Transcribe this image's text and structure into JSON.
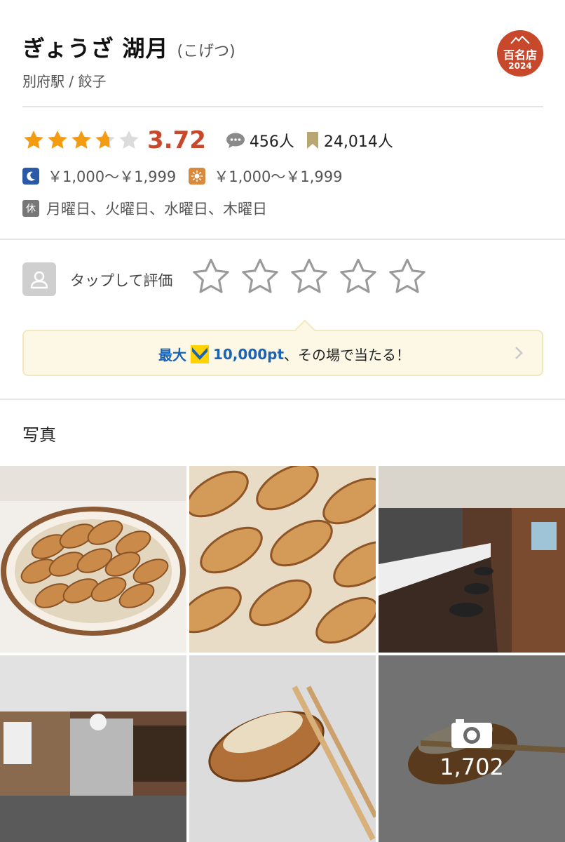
{
  "shop": {
    "name": "ぎょうざ 湖月",
    "kana": "(こげつ)",
    "subtitle": "別府駅 / 餃子",
    "award_label": "百名店",
    "award_year": "2024"
  },
  "rating": {
    "value": 0.744,
    "score": "3.72",
    "reviews": "456人",
    "bookmarks": "24,014人"
  },
  "prices": {
    "dinner": "￥1,000～￥1,999",
    "lunch": "￥1,000～￥1,999"
  },
  "closed": {
    "badge": "休",
    "days": "月曜日、火曜日、水曜日、木曜日"
  },
  "user_rating": {
    "label": "タップして評価",
    "stars": 5
  },
  "promo": {
    "prefix": "最大",
    "points": "10,000pt",
    "suffix": "、その場で当たる！"
  },
  "photos": {
    "section_title": "写真",
    "more_count": "1,702"
  },
  "colors": {
    "accent": "#c8482c",
    "star": "#f39c12",
    "link_blue": "#1a64b6"
  }
}
